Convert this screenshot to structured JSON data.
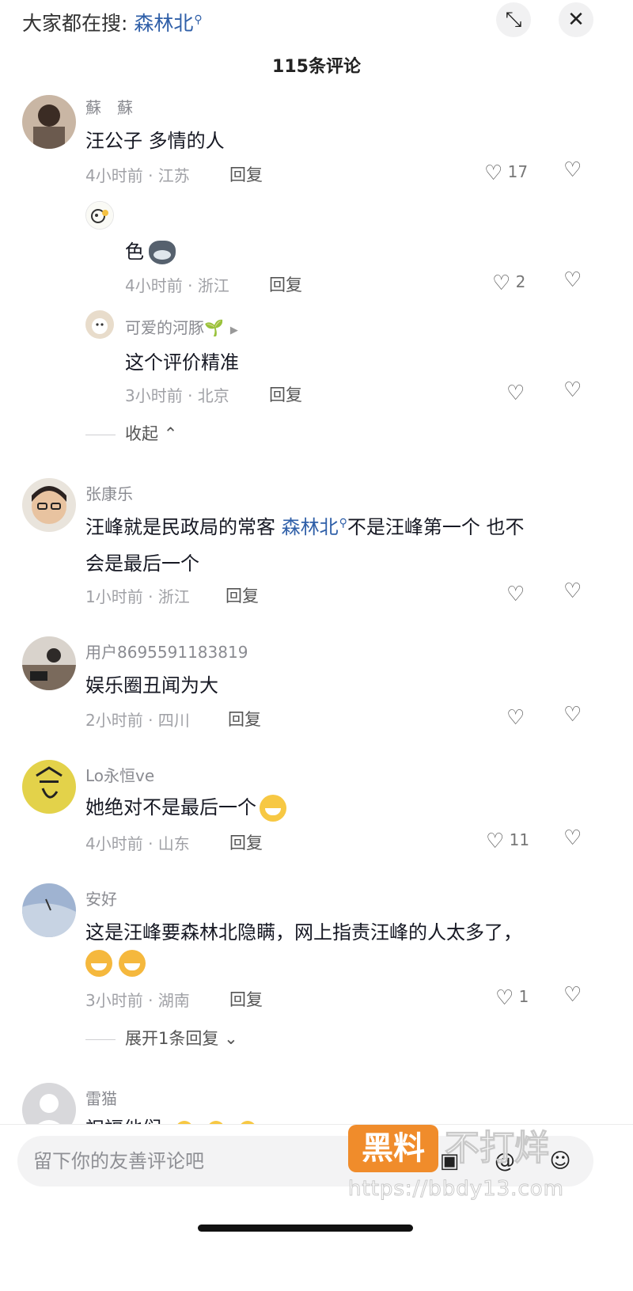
{
  "header": {
    "search_prefix": "大家都在搜:",
    "search_term": "森林北",
    "collapse_icon": "collapse-icon",
    "close_icon": "close-icon",
    "comment_count": "115条评论"
  },
  "comments": [
    {
      "username": "蘇　蘇",
      "text": "汪公子 多情的人",
      "meta": "4小时前 · 江苏",
      "reply": "回复",
      "likes": "17",
      "avatar_color": "#6b5a4e",
      "replies": [
        {
          "username": "",
          "text": "色",
          "meta": "4小时前 · 浙江",
          "reply": "回复",
          "likes": "2",
          "avatar_color": "#f5f5f0"
        },
        {
          "username": "可爱的河豚",
          "text": "这个评价精准",
          "meta": "3小时前 · 北京",
          "reply": "回复",
          "likes": "",
          "avatar_color": "#e8dccb"
        }
      ],
      "collapse_label": "收起"
    },
    {
      "username": "张康乐",
      "text_before": "汪峰就是民政局的常客 ",
      "text_link": "森林北",
      "text_after": "不是汪峰第一个 也不",
      "text_line2": "会是最后一个",
      "meta": "1小时前 · 浙江",
      "reply": "回复",
      "likes": "",
      "avatar_color": "#c9a27e"
    },
    {
      "username": "用户8695591183819",
      "text": "娱乐圈丑闻为大",
      "meta": "2小时前 · 四川",
      "reply": "回复",
      "likes": "",
      "avatar_color": "#7a6a5c"
    },
    {
      "username": "Lo永恒ve",
      "text": "她绝对不是最后一个",
      "meta": "4小时前 · 山东",
      "reply": "回复",
      "likes": "11",
      "avatar_color": "#e3d24a"
    },
    {
      "username": "安好",
      "text": "这是汪峰要森林北隐瞒，网上指责汪峰的人太多了，",
      "meta": "3小时前 · 湖南",
      "reply": "回复",
      "likes": "1",
      "avatar_color": "#9fb3d1",
      "expand_label": "展开1条回复"
    },
    {
      "username": "雷猫",
      "text": "祝福他们",
      "avatar_color": "#cfcfd2"
    }
  ],
  "composer": {
    "placeholder": "留下你的友善评论吧"
  },
  "watermark": {
    "badge": "黑料",
    "text": "不打烊",
    "url": "https://bbdy13.com"
  }
}
